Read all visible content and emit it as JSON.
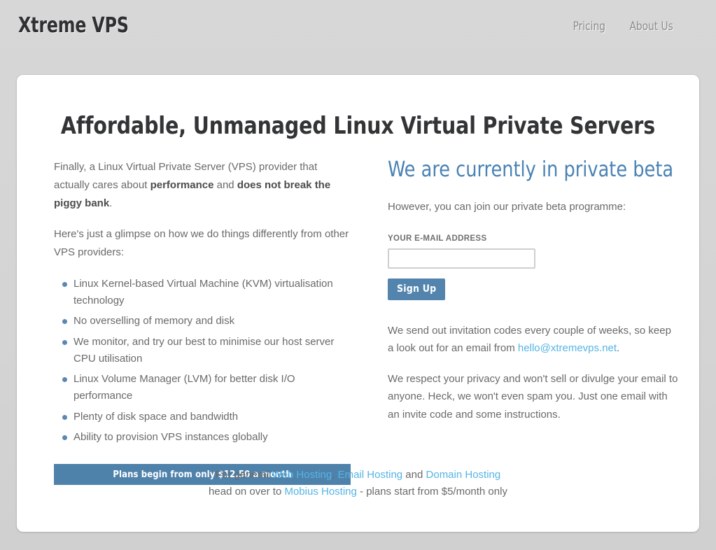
{
  "header": {
    "brand": "Xtreme VPS",
    "nav": [
      {
        "label": "Pricing"
      },
      {
        "label": "About Us"
      }
    ]
  },
  "main": {
    "headline": "Affordable, Unmanaged Linux Virtual Private Servers",
    "left": {
      "intro_lead": "Finally, a Linux Virtual Private Server (VPS) provider that actually cares about ",
      "intro_bold_1": "performance",
      "intro_mid": " and ",
      "intro_bold_2": "does not break the piggy bank",
      "intro_end": ".",
      "glimpse": "Here's just a glimpse on how we do things differently from other VPS providers:",
      "features": [
        "Linux Kernel-based Virtual Machine (KVM) virtualisation technology",
        "No overselling of memory and disk",
        "We monitor, and try our best to minimise our host server CPU utilisation",
        "Linux Volume Manager (LVM) for better disk I/O performance",
        "Plenty of disk space and bandwidth",
        "Ability to provision VPS instances globally"
      ],
      "plans_banner": "Plans begin from only $12.50 a month"
    },
    "right": {
      "beta_heading": "We are currently in private beta",
      "beta_sub": "However, you can join our private beta programme:",
      "email_label": "YOUR E-MAIL ADDRESS",
      "email_value": "",
      "email_placeholder": "",
      "signup_button": "Sign Up",
      "note_1_before": "We send out invitation codes every couple of weeks, so keep a look out for an email from ",
      "note_1_link": "hello@xtremevps.net",
      "note_1_after": ".",
      "note_2": "We respect your privacy and won't sell or divulge your email to anyone. Heck, we won't even spam you. Just one email with an invite code and some instructions."
    }
  },
  "footer": {
    "line1_before": "For general ",
    "link_web": "Web Hosting",
    "line1_sep1": ", ",
    "link_email": "Email Hosting",
    "line1_sep2": " and ",
    "link_domain": "Domain Hosting",
    "line2_before": "head on over to ",
    "link_mobius": "Mobius Hosting",
    "line2_after": " - plans start from $5/month only"
  },
  "colors": {
    "accent_blue": "#4f82ab",
    "link_blue": "#55b4e4",
    "heading_blue": "#4a82b4",
    "bullet_blue": "#5c87b2",
    "page_bg": "#d6d6d6",
    "text_gray": "#6a6a6a"
  }
}
